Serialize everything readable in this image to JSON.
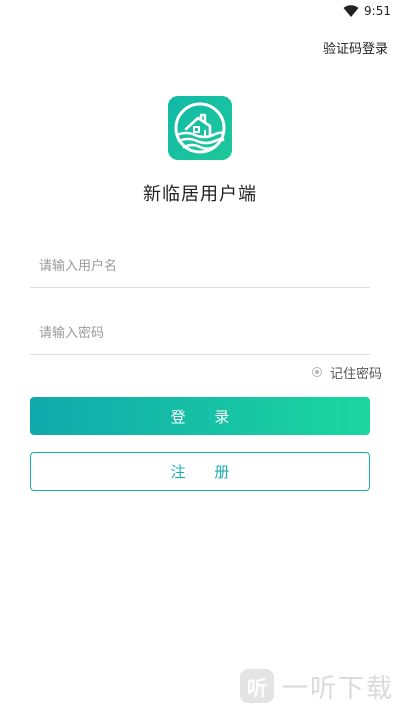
{
  "status_bar": {
    "time": "9:51",
    "wifi_icon": "wifi-icon"
  },
  "header": {
    "sms_login_label": "验证码登录"
  },
  "app": {
    "logo_icon": "house-on-waves-logo",
    "title": "新临居用户端"
  },
  "form": {
    "username": {
      "placeholder": "请输入用户名",
      "value": ""
    },
    "password": {
      "placeholder": "请输入密码",
      "value": ""
    },
    "remember_label": "记住密码"
  },
  "buttons": {
    "login_label": "登 录",
    "register_label": "注 册"
  },
  "watermark": {
    "glyph": "听",
    "text": "一听下载"
  },
  "colors": {
    "accent_start": "#10a9ad",
    "accent_end": "#1cd69e",
    "logo_bg": "#12b8a8",
    "register_border": "#1aaeb0"
  }
}
